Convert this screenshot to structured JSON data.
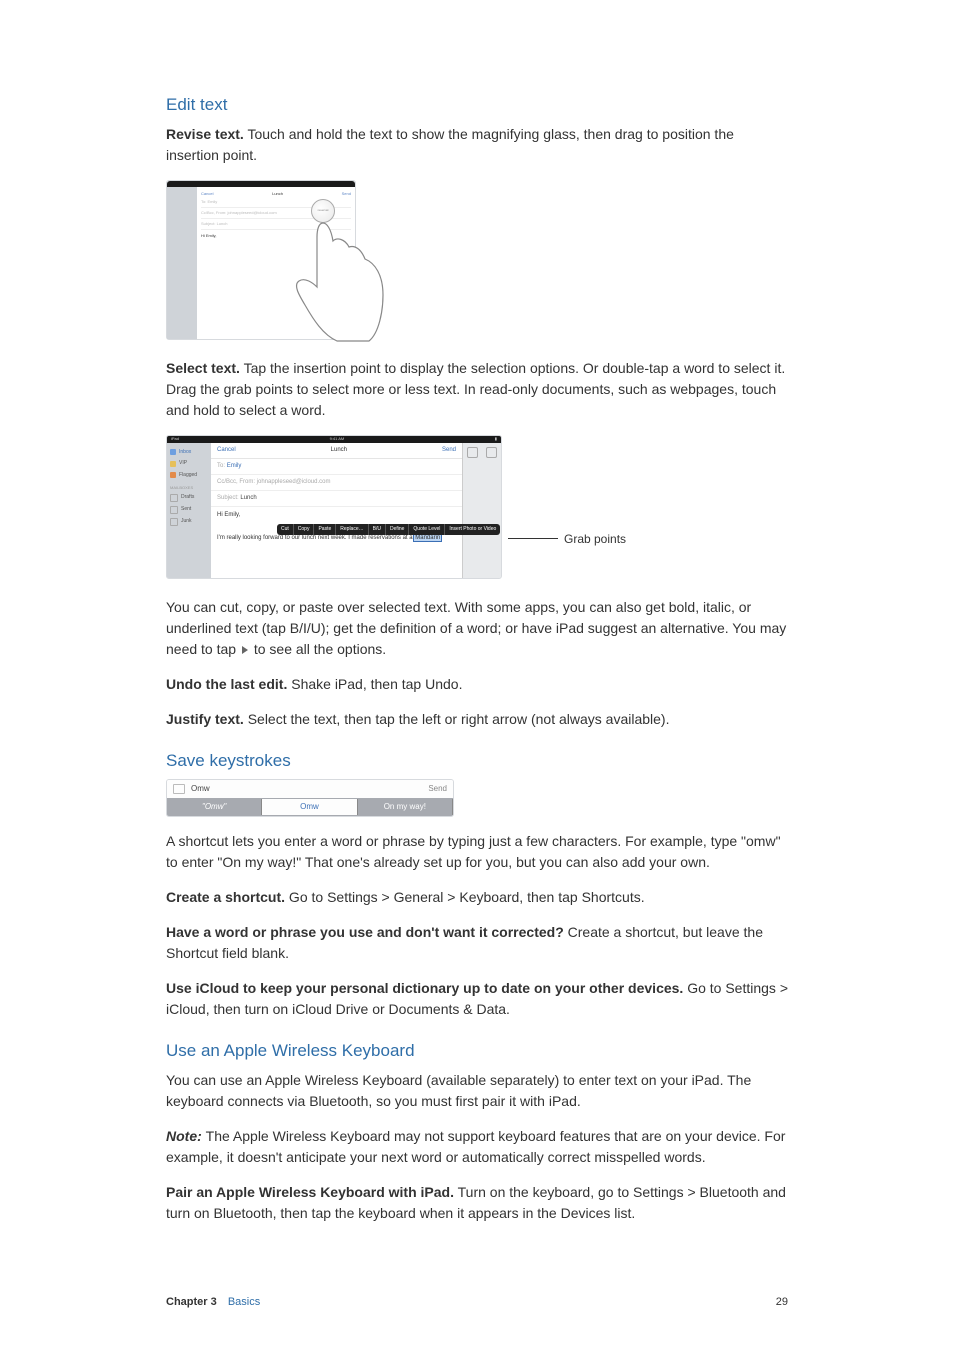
{
  "sections": {
    "edit_text": {
      "heading": "Edit text",
      "revise_lead": "Revise text.",
      "revise_body": " Touch and hold the text to show the magnifying glass, then drag to position the insertion point.",
      "select_lead": "Select text.",
      "select_body": " Tap the insertion point to display the selection options. Or double-tap a word to select it. Drag the grab points to select more or less text. In read-only documents, such as webpages, touch and hold to select a word.",
      "cut_body": "You can cut, copy, or paste over selected text. With some apps, you can also get bold, italic, or underlined text (tap B/I/U); get the definition of a word; or have iPad suggest an alternative. You may need to tap ",
      "cut_body_tail": " to see all the options.",
      "undo_lead": "Undo the last edit.",
      "undo_body": " Shake iPad, then tap Undo.",
      "justify_lead": "Justify text.",
      "justify_body": " Select the text, then tap the left or right arrow (not always available)."
    },
    "save_keystrokes": {
      "heading": "Save keystrokes",
      "intro": "A shortcut lets you enter a word or phrase by typing just a few characters. For example, type \"omw\" to enter \"On my way!\" That one's already set up for you, but you can also add your own.",
      "create_lead": "Create a shortcut.",
      "create_body": " Go to Settings > General > Keyboard, then tap Shortcuts.",
      "notcorrect_lead": "Have a word or phrase you use and don't want it corrected?",
      "notcorrect_body": " Create a shortcut, but leave the Shortcut field blank.",
      "icloud_lead": "Use iCloud to keep your personal dictionary up to date on your other devices.",
      "icloud_body": " Go to Settings > iCloud, then turn on iCloud Drive or Documents & Data."
    },
    "wireless": {
      "heading": "Use an Apple Wireless Keyboard",
      "intro": "You can use an Apple Wireless Keyboard (available separately) to enter text on your iPad. The keyboard connects via Bluetooth, so you must first pair it with iPad.",
      "note_lead": "Note:  ",
      "note_body": "The Apple Wireless Keyboard may not support keyboard features that are on your device. For example, it doesn't anticipate your next word or automatically correct misspelled words.",
      "pair_lead": "Pair an Apple Wireless Keyboard with iPad.",
      "pair_body": " Turn on the keyboard, go to Settings > Bluetooth and turn on Bluetooth, then tap the keyboard when it appears in the Devices list."
    }
  },
  "figures": {
    "fig1": {
      "cancel": "Cancel",
      "title": "Lunch",
      "send": "Send",
      "to": "To: Emily",
      "cc": "Cc/Bcc, From: johnappleseed@icloud.com",
      "subject": "Subject: Lunch",
      "body_start": "Hi Emily,",
      "mag_text": "reservat"
    },
    "fig2": {
      "status_left": "iPad",
      "status_center": "9:41 AM",
      "sidebar_items": [
        "Inbox",
        "VIP",
        "Flagged",
        "Drafts",
        "Sent",
        "Junk"
      ],
      "mailboxes": "MAILBOXES",
      "cancel": "Cancel",
      "title": "Lunch",
      "send": "Send",
      "to_label": "To:",
      "to_val": "Emily",
      "cc": "Cc/Bcc, From: johnappleseed@icloud.com",
      "subject_label": "Subject:",
      "subject_val": "Lunch",
      "greeting": "Hi Emily,",
      "body": "I'm really looking forward to our lunch next week. I made reservations at a ",
      "selected": "Mandarin",
      "popover_items": [
        "Cut",
        "Copy",
        "Paste",
        "Replace…",
        "B/U",
        "Define",
        "Quote Level",
        "Insert Photo or Video"
      ],
      "callout": "Grab points"
    },
    "fig3": {
      "field": "Omw",
      "send": "Send",
      "sugg_left": "\"Omw\"",
      "sugg_mid": "Omw",
      "sugg_right": "On my way!"
    }
  },
  "footer": {
    "chapter_label": "Chapter  3",
    "chapter_name": "Basics",
    "page": "29"
  }
}
